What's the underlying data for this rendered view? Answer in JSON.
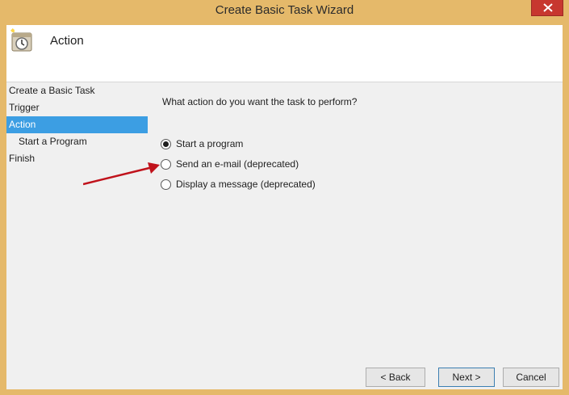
{
  "window": {
    "title": "Create Basic Task Wizard"
  },
  "header": {
    "title": "Action",
    "icon": "clock-task-icon"
  },
  "steps": [
    {
      "label": "Create a Basic Task",
      "sub": false,
      "active": false
    },
    {
      "label": "Trigger",
      "sub": false,
      "active": false
    },
    {
      "label": "Action",
      "sub": false,
      "active": true
    },
    {
      "label": "Start a Program",
      "sub": true,
      "active": false
    },
    {
      "label": "Finish",
      "sub": false,
      "active": false
    }
  ],
  "content": {
    "prompt": "What action do you want the task to perform?",
    "options": [
      {
        "label": "Start a program",
        "checked": true
      },
      {
        "label": "Send an e-mail (deprecated)",
        "checked": false
      },
      {
        "label": "Display a message (deprecated)",
        "checked": false
      }
    ]
  },
  "buttons": {
    "back": "< Back",
    "next": "Next >",
    "cancel": "Cancel"
  },
  "colors": {
    "frame": "#e5b96a",
    "selection": "#3c9ee3",
    "close": "#c7372f",
    "annotation_arrow": "#c0121b"
  }
}
